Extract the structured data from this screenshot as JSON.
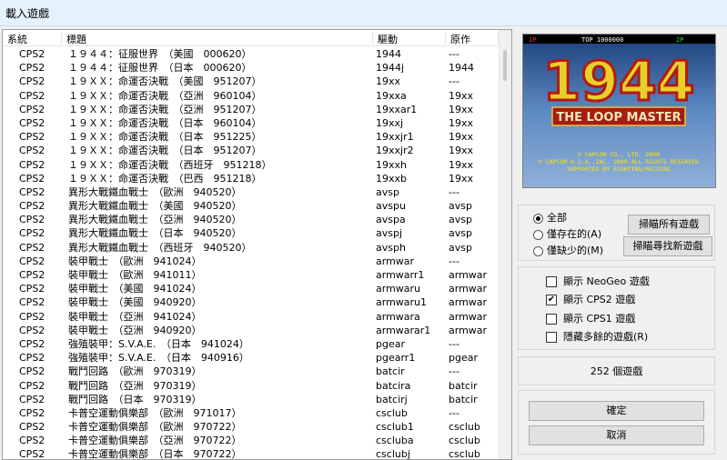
{
  "window": {
    "title": "載入遊戲"
  },
  "list": {
    "columns": [
      "系統",
      "標題",
      "驅動",
      "原作"
    ],
    "rows": [
      [
        "CPS2",
        "１９４４：征服世界　（美國　000620）",
        "1944",
        "---"
      ],
      [
        "CPS2",
        "１９４４：征服世界　（日本　000620）",
        "1944j",
        "1944"
      ],
      [
        "CPS2",
        "１９ＸＸ：命運否決戰　（美國　951207）",
        "19xx",
        "---"
      ],
      [
        "CPS2",
        "１９ＸＸ：命運否決戰　（亞洲　960104）",
        "19xxa",
        "19xx"
      ],
      [
        "CPS2",
        "１９ＸＸ：命運否決戰　（亞洲　951207）",
        "19xxar1",
        "19xx"
      ],
      [
        "CPS2",
        "１９ＸＸ：命運否決戰　（日本　960104）",
        "19xxj",
        "19xx"
      ],
      [
        "CPS2",
        "１９ＸＸ：命運否決戰　（日本　951225）",
        "19xxjr1",
        "19xx"
      ],
      [
        "CPS2",
        "１９ＸＸ：命運否決戰　（日本　951207）",
        "19xxjr2",
        "19xx"
      ],
      [
        "CPS2",
        "１９ＸＸ：命運否決戰　（西班牙　951218）",
        "19xxh",
        "19xx"
      ],
      [
        "CPS2",
        "１９ＸＸ：命運否決戰　（巴西　951218）",
        "19xxb",
        "19xx"
      ],
      [
        "CPS2",
        "異形大戰鐵血戰士　（歐洲　940520）",
        "avsp",
        "---"
      ],
      [
        "CPS2",
        "異形大戰鐵血戰士　（美國　940520）",
        "avspu",
        "avsp"
      ],
      [
        "CPS2",
        "異形大戰鐵血戰士　（亞洲　940520）",
        "avspa",
        "avsp"
      ],
      [
        "CPS2",
        "異形大戰鐵血戰士　（日本　940520）",
        "avspj",
        "avsp"
      ],
      [
        "CPS2",
        "異形大戰鐵血戰士　（西班牙　940520）",
        "avsph",
        "avsp"
      ],
      [
        "CPS2",
        "裝甲戰士　（歐洲　941024）",
        "armwar",
        "---"
      ],
      [
        "CPS2",
        "裝甲戰士　（歐洲　941011）",
        "armwarr1",
        "armwar"
      ],
      [
        "CPS2",
        "裝甲戰士　（美國　941024）",
        "armwaru",
        "armwar"
      ],
      [
        "CPS2",
        "裝甲戰士　（美國　940920）",
        "armwaru1",
        "armwar"
      ],
      [
        "CPS2",
        "裝甲戰士　（亞洲　941024）",
        "armwara",
        "armwar"
      ],
      [
        "CPS2",
        "裝甲戰士　（亞洲　940920）",
        "armwarar1",
        "armwar"
      ],
      [
        "CPS2",
        "強殖裝甲：S.V.A.E.　（日本　941024）",
        "pgear",
        "---"
      ],
      [
        "CPS2",
        "強殖裝甲：S.V.A.E.　（日本　940916）",
        "pgearr1",
        "pgear"
      ],
      [
        "CPS2",
        "戰鬥回路　（歐洲　970319）",
        "batcir",
        "---"
      ],
      [
        "CPS2",
        "戰鬥回路　（亞洲　970319）",
        "batcira",
        "batcir"
      ],
      [
        "CPS2",
        "戰鬥回路　（日本　970319）",
        "batcirj",
        "batcir"
      ],
      [
        "CPS2",
        "卡普空運動俱樂部　（歐洲　971017）",
        "csclub",
        "---"
      ],
      [
        "CPS2",
        "卡普空運動俱樂部　（歐洲　970722）",
        "csclub1",
        "csclub"
      ],
      [
        "CPS2",
        "卡普空運動俱樂部　（亞洲　970722）",
        "cscluba",
        "csclub"
      ],
      [
        "CPS2",
        "卡普空運動俱樂部　（日本　970722）",
        "csclubj",
        "csclub"
      ]
    ]
  },
  "preview": {
    "hud_top": "TOP 1000000",
    "hud_1p": "1P",
    "hud_2p": "2P",
    "logo": "1944",
    "subtitle": "THE LOOP MASTER",
    "credit1": "© CAPCOM CO., LTD. 2000",
    "credit2": "© CAPCOM U.S.A.,INC. 2000 ALL RIGHTS RESERVED",
    "credit3": "SUPPORTED BY EIGHTING/RAIZING"
  },
  "filter": {
    "options": [
      "全部",
      "僅存在的(A)",
      "僅缺少的(M)"
    ],
    "selected": "全部"
  },
  "buttons": {
    "scan_all": "掃瞄所有遊戲",
    "scan_new": "掃瞄尋找新遊戲",
    "ok": "確定",
    "cancel": "取消"
  },
  "checkboxes": [
    {
      "label": "顯示 NeoGeo 遊戲",
      "checked": false
    },
    {
      "label": "顯示 CPS2 遊戲",
      "checked": true
    },
    {
      "label": "顯示 CPS1 遊戲",
      "checked": false
    },
    {
      "label": "隱藏多餘的遊戲(R)",
      "checked": false
    }
  ],
  "count_text": "252 個遊戲"
}
